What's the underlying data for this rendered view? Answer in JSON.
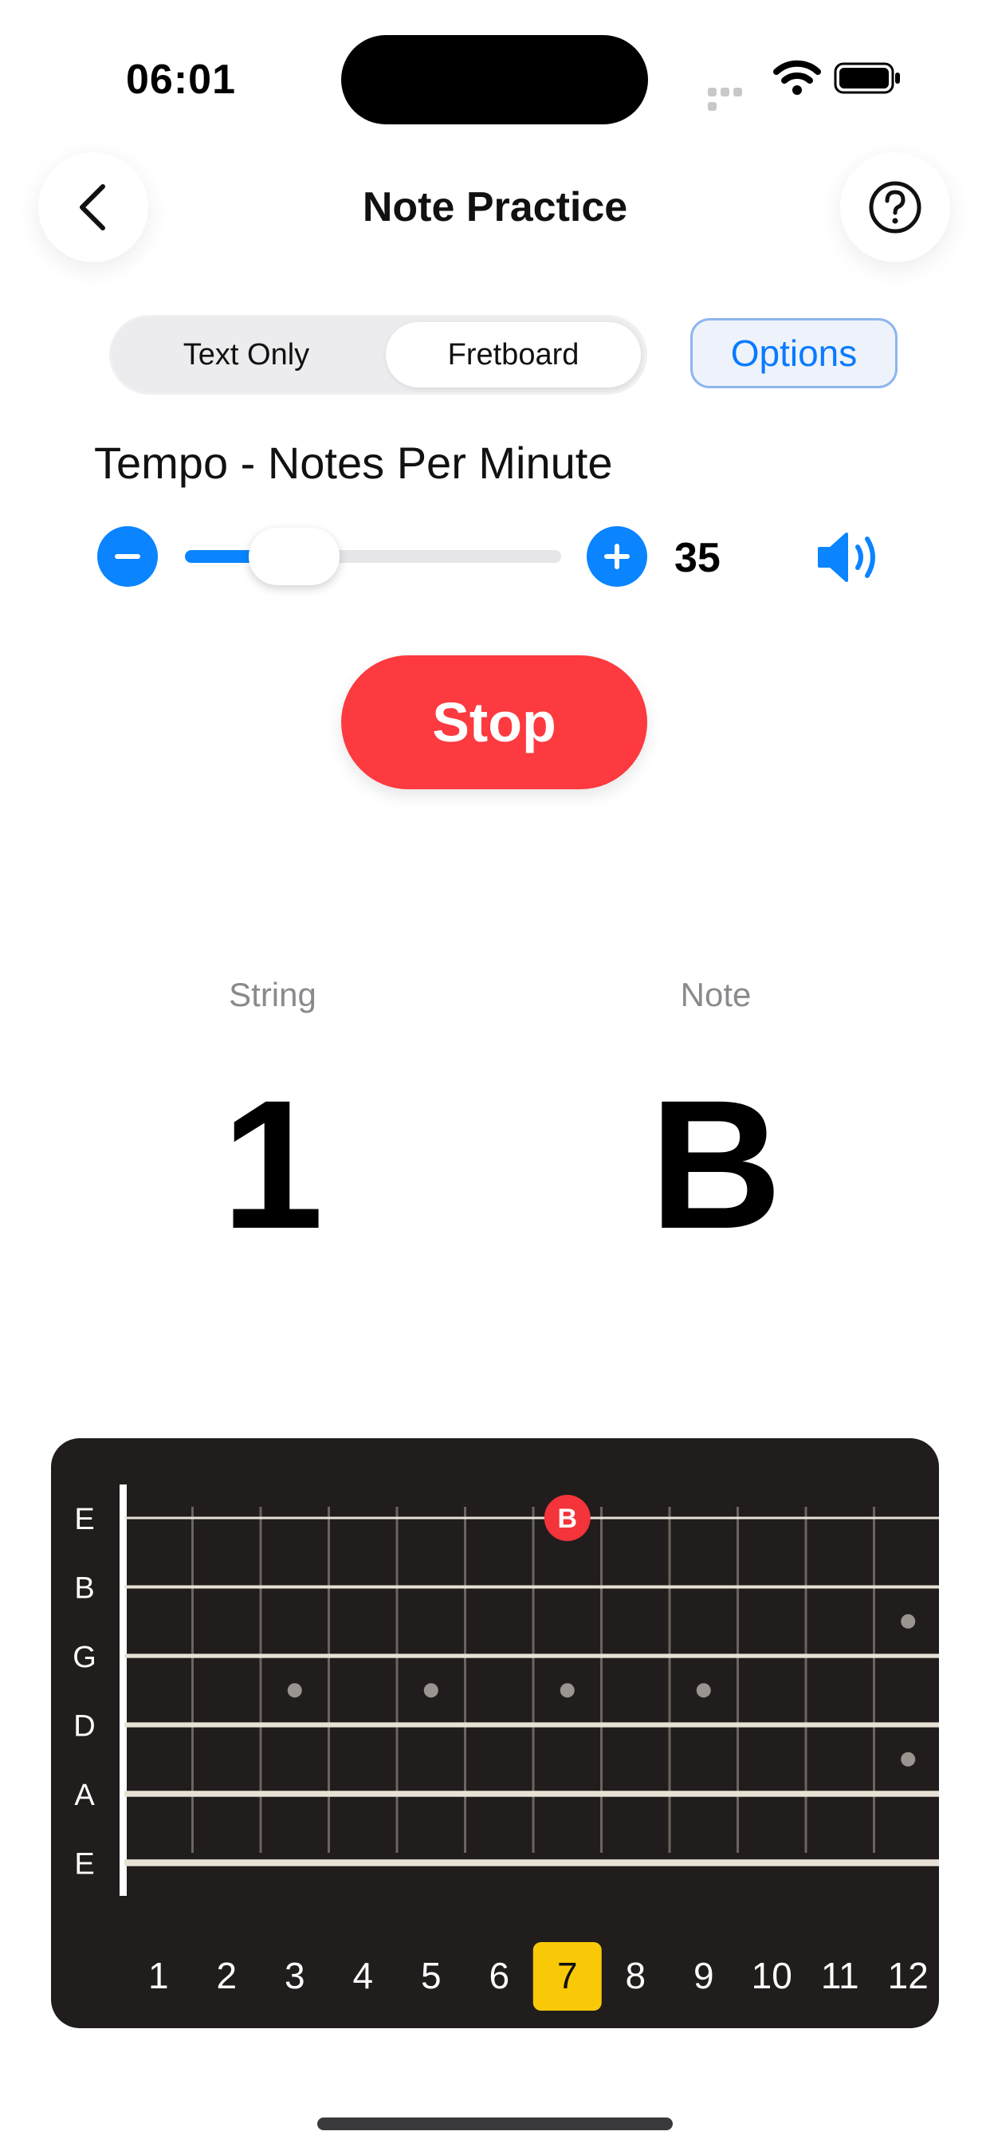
{
  "status_bar": {
    "time": "06:01",
    "icons": [
      "signal-dots-icon",
      "wifi-icon",
      "battery-icon"
    ]
  },
  "nav": {
    "title": "Note Practice",
    "back_icon": "chevron-left-icon",
    "help_icon": "question-circle-icon"
  },
  "mode_selector": {
    "options": [
      "Text Only",
      "Fretboard"
    ],
    "selected": "Fretboard"
  },
  "options_button": {
    "label": "Options"
  },
  "tempo": {
    "label": "Tempo - Notes Per Minute",
    "value": "35",
    "slider_fraction": 0.29,
    "minus_icon": "minus-circle-icon",
    "plus_icon": "plus-circle-icon",
    "sound_icon": "speaker-wave-icon"
  },
  "stop_button": {
    "label": "Stop"
  },
  "readout": {
    "string_label": "String",
    "string_value": "1",
    "note_label": "Note",
    "note_value": "B"
  },
  "fretboard": {
    "strings": [
      "E",
      "B",
      "G",
      "D",
      "A",
      "E"
    ],
    "frets": [
      "1",
      "2",
      "3",
      "4",
      "5",
      "6",
      "7",
      "8",
      "9",
      "10",
      "11",
      "12"
    ],
    "highlighted_fret": "7",
    "marker": {
      "string_index": 0,
      "fret": 7,
      "label": "B"
    },
    "inlay_dots": [
      {
        "fret": 3,
        "between_strings": [
          2,
          3
        ]
      },
      {
        "fret": 5,
        "between_strings": [
          2,
          3
        ]
      },
      {
        "fret": 7,
        "between_strings": [
          2,
          3
        ]
      },
      {
        "fret": 9,
        "between_strings": [
          2,
          3
        ]
      },
      {
        "fret": 12,
        "between_strings": [
          1,
          2
        ]
      },
      {
        "fret": 12,
        "between_strings": [
          3,
          4
        ]
      }
    ],
    "colors": {
      "background": "#201d1c",
      "marker": "#f4333a",
      "highlight": "#f9c907",
      "inlay": "#9a9590"
    }
  }
}
